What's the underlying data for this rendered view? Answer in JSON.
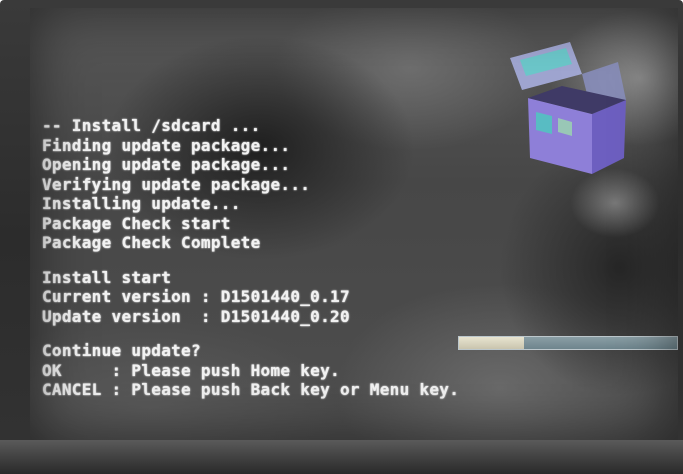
{
  "console": {
    "lines": [
      "-- Install /sdcard ...",
      "Finding update package...",
      "Opening update package...",
      "Verifying update package...",
      "Installing update...",
      "Package Check start",
      "Package Check Complete",
      "",
      "Install start",
      "Current version : D1501440_0.17",
      "Update version  : D1501440_0.20",
      "",
      "Continue update?",
      "OK     : Please push Home key.",
      "CANCEL : Please push Back key or Menu key."
    ]
  },
  "progress": {
    "fraction": 0.3
  },
  "colors": {
    "console_text": "#f2f2f2",
    "screen_bg": "#4e4e4e",
    "box_purple": "#8e7fd8",
    "box_teal": "#4fc7c0"
  },
  "icons": {
    "update_box": "open-box-icon"
  }
}
